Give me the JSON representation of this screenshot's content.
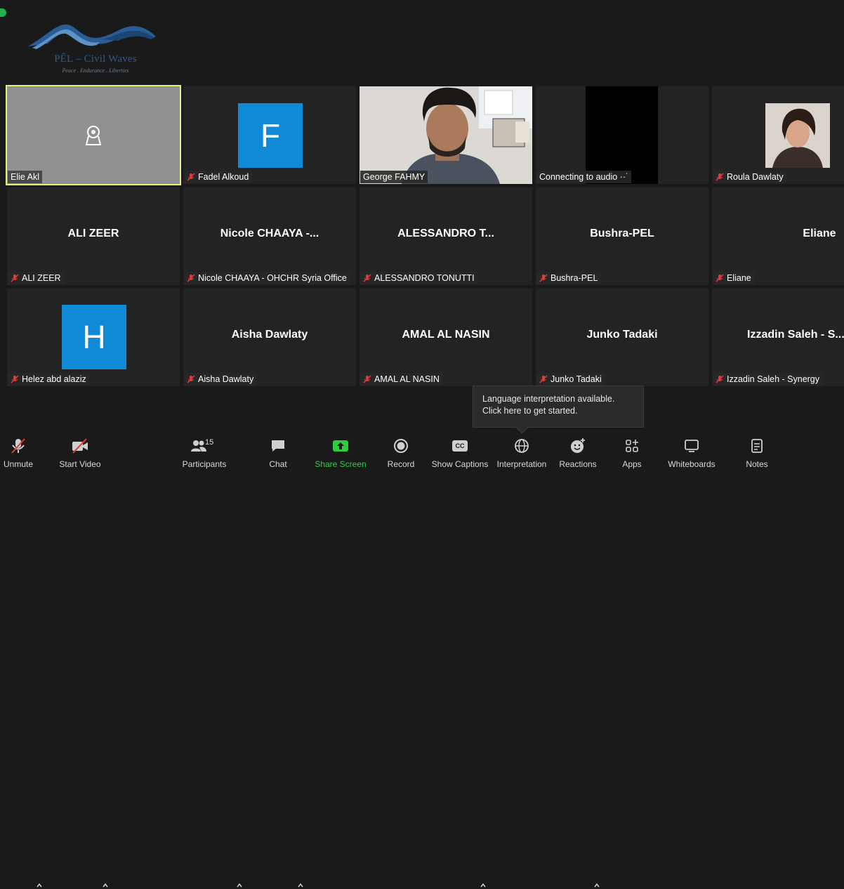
{
  "logo": {
    "title": "PÊL – Civil Waves",
    "tagline": "Peace . Endurance . Liberties"
  },
  "tiles": [
    {
      "name": "Elie Akl",
      "muted": false
    },
    {
      "name": "Fadel Alkoud",
      "avatar_letter": "F",
      "muted": true
    },
    {
      "name": "George FAHMY",
      "muted": false
    },
    {
      "name": "Connecting to audio ··˙",
      "muted": false
    },
    {
      "name": "Roula Dawlaty",
      "muted": true
    },
    {
      "display": "ALI ZEER",
      "name": "ALI ZEER",
      "muted": true
    },
    {
      "display": "Nicole  CHAAYA  -...",
      "name": "Nicole CHAAYA - OHCHR Syria Office",
      "muted": true
    },
    {
      "display": "ALESSANDRO  T...",
      "name": "ALESSANDRO TONUTTI",
      "muted": true
    },
    {
      "display": "Bushra-PEL",
      "name": "Bushra-PEL",
      "muted": true
    },
    {
      "display": "Eliane",
      "name": "Eliane",
      "muted": true
    },
    {
      "name": "Helez abd alaziz",
      "avatar_letter": "H",
      "muted": true
    },
    {
      "display": "Aisha Dawlaty",
      "name": "Aisha Dawlaty",
      "muted": true
    },
    {
      "display": "AMAL AL NASIN",
      "name": "AMAL AL NASIN",
      "muted": true
    },
    {
      "display": "Junko Tadaki",
      "name": "Junko Tadaki",
      "muted": true
    },
    {
      "display": "Izzadin Saleh - S...",
      "name": "Izzadin Saleh - Synergy",
      "muted": true
    }
  ],
  "tooltip": {
    "line1": "Language interpretation available.",
    "line2": "Click here to get started."
  },
  "toolbar": {
    "unmute": "Unmute",
    "start_video": "Start Video",
    "participants": "Participants",
    "participants_count": "15",
    "chat": "Chat",
    "share_screen": "Share Screen",
    "record": "Record",
    "show_captions": "Show Captions",
    "cc": "CC",
    "interpretation": "Interpretation",
    "reactions": "Reactions",
    "apps": "Apps",
    "whiteboards": "Whiteboards",
    "notes": "Notes"
  },
  "colors": {
    "background": "#1a1a1a",
    "tile": "#232323",
    "active_speaker": "#e6f07a",
    "share_green": "#2ecc40",
    "avatar_blue": "#0e8ad7",
    "mute_red": "#e03b3b"
  }
}
